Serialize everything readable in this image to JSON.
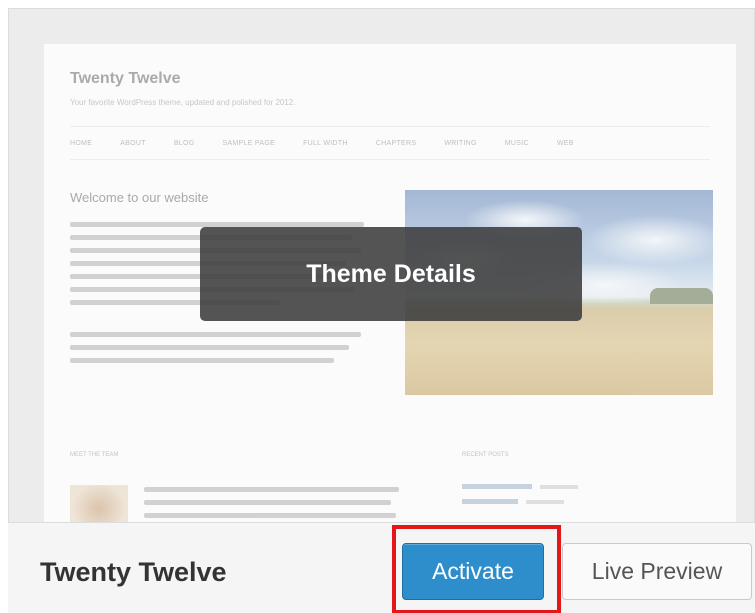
{
  "preview": {
    "site_title": "Twenty Twelve",
    "site_description": "Your favorite WordPress theme, updated and polished for 2012.",
    "nav_items": [
      "HOME",
      "ABOUT",
      "BLOG",
      "SAMPLE PAGE",
      "FULL WIDTH",
      "CHAPTERS",
      "WRITING",
      "MUSIC",
      "WEB"
    ],
    "welcome_heading": "Welcome to our website",
    "meet_heading": "MEET THE TEAM",
    "recent_heading": "RECENT POSTS"
  },
  "overlay": {
    "theme_details_label": "Theme Details"
  },
  "footer": {
    "theme_name": "Twenty Twelve",
    "activate_label": "Activate",
    "live_preview_label": "Live Preview"
  },
  "colors": {
    "activate_bg": "#2e8ecc",
    "highlight_border": "#e3161a"
  }
}
